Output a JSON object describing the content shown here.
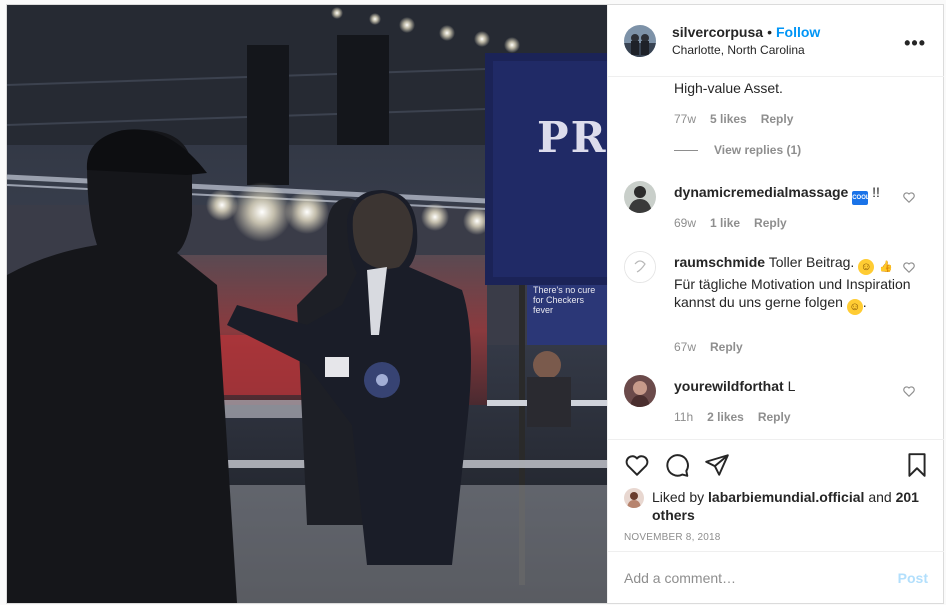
{
  "post": {
    "username": "silvercorpusa",
    "follow_label": "Follow",
    "separator": "•",
    "location": "Charlotte, North Carolina",
    "more_label": "•••",
    "photo_sign_text": "PR",
    "photo_sign_small": "There's no cure for Checkers fever"
  },
  "comments": {
    "first": {
      "text": "High-value Asset.",
      "time": "77w",
      "likes": "5 likes",
      "reply": "Reply",
      "view_replies": "View replies (1)"
    },
    "items": [
      {
        "username": "dynamicremedialmassage",
        "text": "!!",
        "emoji": "COOL",
        "time": "69w",
        "likes": "1 like",
        "reply": "Reply"
      },
      {
        "username": "raumschmide",
        "text_a": "Toller Beitrag.",
        "text_b": "Für tägliche Motivation und Inspiration kannst du uns gerne folgen",
        "text_c": ".",
        "time": "67w",
        "reply": "Reply"
      },
      {
        "username": "yourewildforthat",
        "text": "L",
        "time": "11h",
        "likes": "2 likes",
        "reply": "Reply"
      }
    ]
  },
  "actions": {
    "liked_prefix": "Liked by",
    "liked_user": "labarbiemundial.official",
    "liked_and": "and",
    "liked_others": "201 others",
    "date": "NOVEMBER 8, 2018"
  },
  "add_comment": {
    "placeholder": "Add a comment…",
    "post_label": "Post"
  },
  "icons": {
    "more": "more-options-icon",
    "like": "heart-icon",
    "comment": "comment-icon",
    "share": "share-icon",
    "save": "bookmark-icon"
  }
}
